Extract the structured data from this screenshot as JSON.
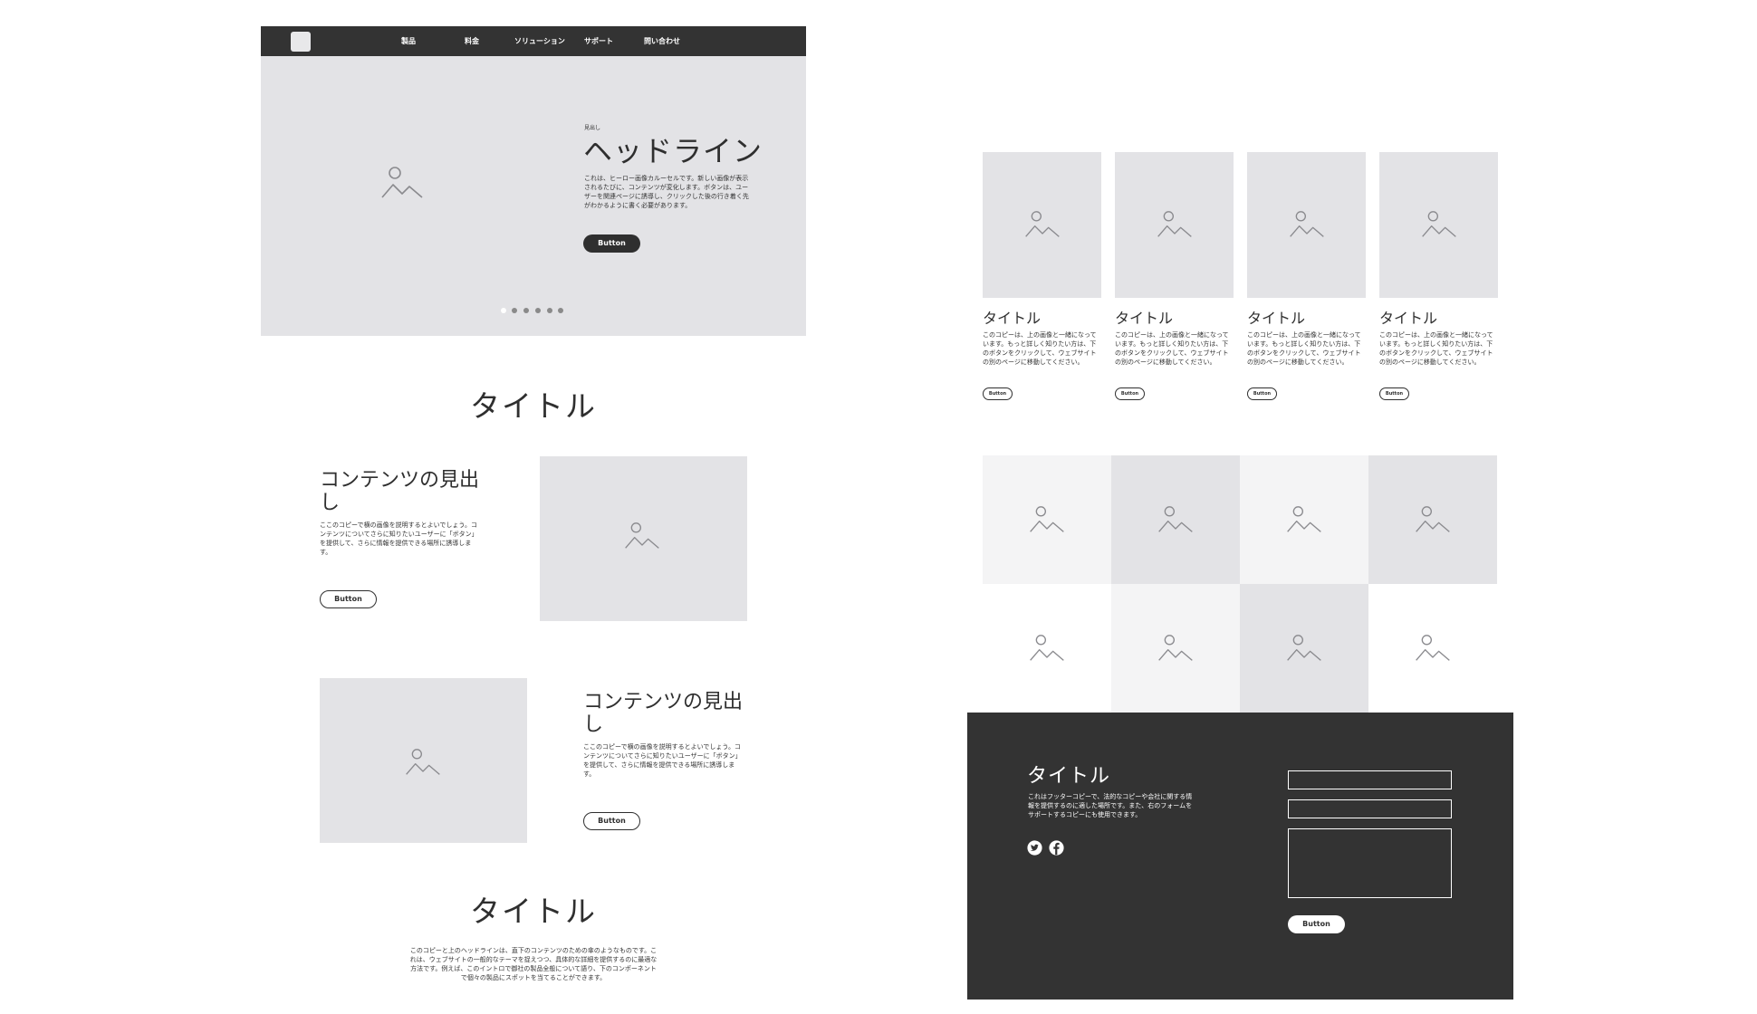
{
  "nav": {
    "items": [
      "製品",
      "料金",
      "ソリューション",
      "サポート",
      "問い合わせ"
    ]
  },
  "hero": {
    "eyebrow": "見出し",
    "headline": "ヘッドライン",
    "body": "これは、ヒーロー画像カルーセルです。新しい画像が表示されるたびに、コンテンツが変化します。ボタンは、ユーザーを関連ページに誘導し、クリックした後の行き着く先がわかるように書く必要があります。",
    "button_label": "Button",
    "slide_count": 6,
    "active_slide": 1
  },
  "section_title_1": "タイトル",
  "content_block_1": {
    "heading": "コンテンツの見出し",
    "body": "ここのコピーで横の画像を説明するとよいでしょう。コンテンツについてさらに知りたいユーザーに「ボタン」を提供して、さらに情報を提供できる場所に誘導します。",
    "button_label": "Button"
  },
  "content_block_2": {
    "heading": "コンテンツの見出し",
    "body": "ここのコピーで横の画像を説明するとよいでしょう。コンテンツについてさらに知りたいユーザーに「ボタン」を提供して、さらに情報を提供できる場所に誘導します。",
    "button_label": "Button"
  },
  "section_title_2": "タイトル",
  "bottom_body": "このコピーと上のヘッドラインは、直下のコンテンツのための傘のようなものです。これは、ウェブサイトの一般的なテーマを捉えつつ、具体的な詳細を提供するのに最適な方法です。例えば、このイントロで御社の製品全般について語り、下のコンポーネントで個々の製品にスポットを当てることができます。",
  "cards": [
    {
      "title": "タイトル",
      "body": "このコピーは、上の画像と一緒になっています。もっと詳しく知りたい方は、下のボタンをクリックして、ウェブサイトの別のページに移動してください。",
      "button_label": "Button"
    },
    {
      "title": "タイトル",
      "body": "このコピーは、上の画像と一緒になっています。もっと詳しく知りたい方は、下のボタンをクリックして、ウェブサイトの別のページに移動してください。",
      "button_label": "Button"
    },
    {
      "title": "タイトル",
      "body": "このコピーは、上の画像と一緒になっています。もっと詳しく知りたい方は、下のボタンをクリックして、ウェブサイトの別のページに移動してください。",
      "button_label": "Button"
    },
    {
      "title": "タイトル",
      "body": "このコピーは、上の画像と一緒になっています。もっと詳しく知りたい方は、下のボタンをクリックして、ウェブサイトの別のページに移動してください。",
      "button_label": "Button"
    }
  ],
  "gallery": {
    "tile_colors": [
      "#f4f4f5",
      "#e3e3e6",
      "#f4f4f5",
      "#e3e3e6",
      "#ffffff",
      "#f4f4f5",
      "#e3e3e6",
      "#ffffff"
    ]
  },
  "footer": {
    "title": "タイトル",
    "body": "これはフッターコピーで、法的なコピーや会社に関する情報を提供するのに適した場所です。また、右のフォームをサポートするコピーにも使用できます。",
    "social_icons": [
      "twitter-icon",
      "facebook-icon"
    ],
    "button_label": "Button"
  },
  "colors": {
    "dark": "#333333",
    "placeholder": "#e3e3e6",
    "placeholder_light": "#f4f4f5",
    "icon_stroke": "#8a8a8e"
  }
}
